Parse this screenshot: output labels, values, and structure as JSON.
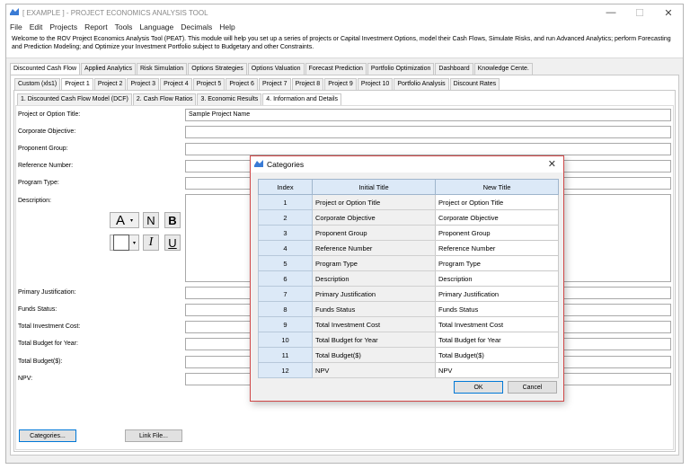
{
  "app": {
    "title": "[ EXAMPLE ] - PROJECT ECONOMICS ANALYSIS TOOL",
    "controls": {
      "minimize": "—",
      "maximize": "☐",
      "close": "✕"
    }
  },
  "menu": [
    "File",
    "Edit",
    "Projects",
    "Report",
    "Tools",
    "Language",
    "Decimals",
    "Help"
  ],
  "welcome": "Welcome to the ROV Project Economics Analysis Tool (PEAT). This module will help you set up a series of projects or Capital Investment Options, model their Cash Flows, Simulate Risks, and run Advanced Analytics; perform Forecasting and Prediction Modeling; and Optimize your Investment Portfolio subject to Budgetary and other Constraints.",
  "main_tabs": [
    "Discounted Cash Flow",
    "Applied Analytics",
    "Risk Simulation",
    "Options Strategies",
    "Options Valuation",
    "Forecast Prediction",
    "Portfolio Optimization",
    "Dashboard",
    "Knowledge Cente."
  ],
  "project_tabs": [
    "Custom (xls1)",
    "Project 1",
    "Project 2",
    "Project 3",
    "Project 4",
    "Project 5",
    "Project 6",
    "Project 7",
    "Project 8",
    "Project 9",
    "Project 10",
    "Portfolio Analysis",
    "Discount Rates"
  ],
  "sub_tabs": [
    "1. Discounted Cash Flow Model (DCF)",
    "2. Cash Flow Ratios",
    "3. Economic Results",
    "4. Information and Details"
  ],
  "fields": {
    "project_title": {
      "label": "Project or Option Title:",
      "value": "Sample Project Name"
    },
    "corporate_objective": {
      "label": "Corporate Objective:",
      "value": ""
    },
    "proponent_group": {
      "label": "Proponent Group:",
      "value": ""
    },
    "reference_number": {
      "label": "Reference Number:",
      "value": ""
    },
    "program_type": {
      "label": "Program Type:",
      "value": ""
    },
    "description": {
      "label": "Description:",
      "value": ""
    },
    "primary_justification": {
      "label": "Primary Justification:",
      "value": ""
    },
    "funds_status": {
      "label": "Funds Status:",
      "value": ""
    },
    "total_investment_cost": {
      "label": "Total Investment Cost:",
      "value": ""
    },
    "total_budget_year": {
      "label": "Total Budget for Year:",
      "value": ""
    },
    "total_budget": {
      "label": "Total Budget($):",
      "value": ""
    },
    "npv": {
      "label": "NPV:",
      "value": ""
    }
  },
  "format_toolbar": {
    "font_color": "A",
    "normal": "N",
    "bold": "B",
    "italic": "I",
    "underline": "U"
  },
  "buttons": {
    "categories": "Categories...",
    "link_file": "Link File..."
  },
  "dialog": {
    "title": "Categories",
    "columns": [
      "Index",
      "Initial Title",
      "New Title"
    ],
    "rows": [
      {
        "index": "1",
        "initial": "Project or Option Title",
        "new": "Project or Option Title"
      },
      {
        "index": "2",
        "initial": "Corporate Objective",
        "new": "Corporate Objective"
      },
      {
        "index": "3",
        "initial": "Proponent Group",
        "new": "Proponent Group"
      },
      {
        "index": "4",
        "initial": "Reference Number",
        "new": "Reference Number"
      },
      {
        "index": "5",
        "initial": "Program Type",
        "new": "Program Type"
      },
      {
        "index": "6",
        "initial": "Description",
        "new": "Description"
      },
      {
        "index": "7",
        "initial": "Primary Justification",
        "new": "Primary Justification"
      },
      {
        "index": "8",
        "initial": "Funds Status",
        "new": "Funds Status"
      },
      {
        "index": "9",
        "initial": "Total Investment Cost",
        "new": "Total Investment Cost"
      },
      {
        "index": "10",
        "initial": "Total Budget for Year",
        "new": "Total Budget for Year"
      },
      {
        "index": "11",
        "initial": "Total Budget($)",
        "new": "Total Budget($)"
      },
      {
        "index": "12",
        "initial": "NPV",
        "new": "NPV"
      }
    ],
    "ok": "OK",
    "cancel": "Cancel",
    "close": "✕"
  },
  "colors": {
    "dialog_border": "#d04848",
    "header_blue": "#dce9f7",
    "primary_button_border": "#0078d7"
  }
}
